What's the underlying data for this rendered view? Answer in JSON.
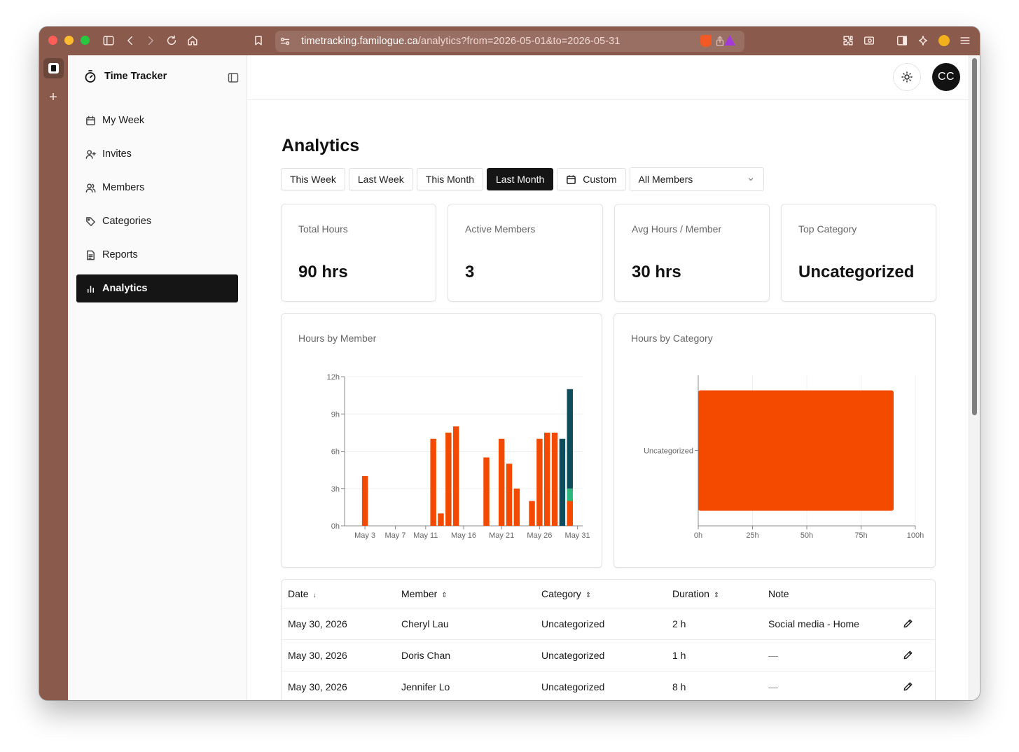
{
  "browser": {
    "url_host": "timetracking.familogue.ca",
    "url_path": "/analytics?from=2026-05-01&to=2026-05-31"
  },
  "app": {
    "name": "Time Tracker",
    "avatar_initials": "CC"
  },
  "sidebar": {
    "items": [
      {
        "label": "My Week",
        "icon": "calendar-icon",
        "active": false
      },
      {
        "label": "Invites",
        "icon": "user-plus-icon",
        "active": false
      },
      {
        "label": "Members",
        "icon": "users-icon",
        "active": false
      },
      {
        "label": "Categories",
        "icon": "tag-icon",
        "active": false
      },
      {
        "label": "Reports",
        "icon": "file-text-icon",
        "active": false
      },
      {
        "label": "Analytics",
        "icon": "bar-chart-icon",
        "active": true
      }
    ]
  },
  "page": {
    "title": "Analytics",
    "filters": [
      {
        "label": "This Week",
        "active": false
      },
      {
        "label": "Last Week",
        "active": false
      },
      {
        "label": "This Month",
        "active": false
      },
      {
        "label": "Last Month",
        "active": true
      }
    ],
    "custom_label": "Custom",
    "member_select": "All Members"
  },
  "stats": [
    {
      "label": "Total Hours",
      "value": "90 hrs"
    },
    {
      "label": "Active Members",
      "value": "3"
    },
    {
      "label": "Avg Hours / Member",
      "value": "30 hrs"
    },
    {
      "label": "Top Category",
      "value": "Uncategorized"
    }
  ],
  "colors": {
    "orange": "#f34a00",
    "teal": "#0e4d5e",
    "green": "#2cb67d",
    "accent_dark": "#151515"
  },
  "chart_data": [
    {
      "type": "bar",
      "title": "Hours by Member",
      "stacked": true,
      "x": [
        "May 1",
        "May 2",
        "May 3",
        "May 4",
        "May 5",
        "May 6",
        "May 7",
        "May 8",
        "May 9",
        "May 10",
        "May 11",
        "May 12",
        "May 13",
        "May 14",
        "May 15",
        "May 16",
        "May 17",
        "May 18",
        "May 19",
        "May 20",
        "May 21",
        "May 22",
        "May 23",
        "May 24",
        "May 25",
        "May 26",
        "May 27",
        "May 28",
        "May 29",
        "May 30",
        "May 31"
      ],
      "x_tick_labels": [
        "May 3",
        "May 7",
        "May 11",
        "May 16",
        "May 21",
        "May 26",
        "May 31"
      ],
      "series": [
        {
          "color": "#f34a00",
          "values": [
            0,
            0,
            4,
            0,
            0,
            0,
            0,
            0,
            0,
            0,
            0,
            7,
            1,
            7.5,
            8,
            0,
            0,
            0,
            5.5,
            0,
            7,
            5,
            3,
            0,
            2,
            7,
            7.5,
            7.5,
            0,
            2,
            0
          ]
        },
        {
          "color": "#2cb67d",
          "values": [
            0,
            0,
            0,
            0,
            0,
            0,
            0,
            0,
            0,
            0,
            0,
            0,
            0,
            0,
            0,
            0,
            0,
            0,
            0,
            0,
            0,
            0,
            0,
            0,
            0,
            0,
            0,
            0,
            0,
            1,
            0
          ]
        },
        {
          "color": "#0e4d5e",
          "values": [
            0,
            0,
            0,
            0,
            0,
            0,
            0,
            0,
            0,
            0,
            0,
            0,
            0,
            0,
            0,
            0,
            0,
            0,
            0,
            0,
            0,
            0,
            0,
            0,
            0,
            0,
            0,
            0,
            7,
            8,
            0
          ]
        }
      ],
      "y_ticks": [
        "0h",
        "3h",
        "6h",
        "9h",
        "12h"
      ],
      "ylim": [
        0,
        12
      ]
    },
    {
      "type": "bar",
      "orientation": "horizontal",
      "title": "Hours by Category",
      "categories": [
        "Uncategorized"
      ],
      "values": [
        90
      ],
      "color": "#f34a00",
      "x_ticks": [
        "0h",
        "25h",
        "50h",
        "75h",
        "100h"
      ],
      "xlim": [
        0,
        100
      ]
    }
  ],
  "table": {
    "headers": {
      "date": "Date",
      "member": "Member",
      "category": "Category",
      "duration": "Duration",
      "note": "Note"
    },
    "rows": [
      {
        "date": "May 30, 2026",
        "member": "Cheryl Lau",
        "category": "Uncategorized",
        "duration": "2 h",
        "note": "Social media - Home"
      },
      {
        "date": "May 30, 2026",
        "member": "Doris Chan",
        "category": "Uncategorized",
        "duration": "1 h",
        "note": "—"
      },
      {
        "date": "May 30, 2026",
        "member": "Jennifer Lo",
        "category": "Uncategorized",
        "duration": "8 h",
        "note": "—"
      }
    ]
  }
}
